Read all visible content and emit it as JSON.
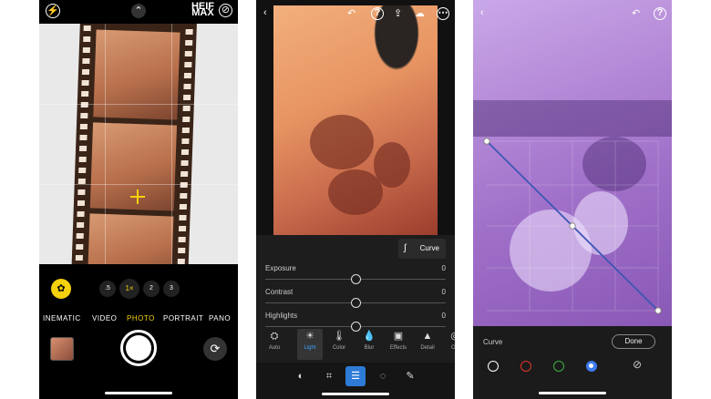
{
  "camera": {
    "format_label_top": "HEIF",
    "format_label_bottom": "MAX",
    "zoom_levels": [
      ".5",
      "1×",
      "2",
      "3"
    ],
    "active_zoom": "1×",
    "modes": [
      "INEMATIC",
      "VIDEO",
      "PHOTO",
      "PORTRAIT",
      "PANO"
    ],
    "active_mode": "PHOTO"
  },
  "editor": {
    "curve_button_label": "Curve",
    "sliders": [
      {
        "label": "Exposure",
        "value": "0",
        "position": 0.5
      },
      {
        "label": "Contrast",
        "value": "0",
        "position": 0.5
      },
      {
        "label": "Highlights",
        "value": "0",
        "position": 0.5
      }
    ],
    "tools": [
      {
        "label": "Auto",
        "icon": "auto-icon"
      },
      {
        "label": "Light",
        "icon": "sun-icon"
      },
      {
        "label": "Color",
        "icon": "thermometer-icon"
      },
      {
        "label": "Blur",
        "icon": "drop-icon"
      },
      {
        "label": "Effects",
        "icon": "effects-icon"
      },
      {
        "label": "Detail",
        "icon": "triangle-icon"
      },
      {
        "label": "Op",
        "icon": "optics-icon"
      }
    ],
    "active_tool": "Light",
    "accent_color": "#2d7bd6"
  },
  "curve_view": {
    "label": "Curve",
    "done_label": "Done",
    "channels": [
      {
        "name": "rgb",
        "color": "#ffffff"
      },
      {
        "name": "red",
        "color": "#e0362c"
      },
      {
        "name": "green",
        "color": "#3cb043"
      },
      {
        "name": "blue",
        "color": "#3e7bf0"
      }
    ],
    "active_channel": "blue",
    "curve_points": [
      [
        0,
        1
      ],
      [
        0.5,
        0.5
      ],
      [
        1,
        0
      ]
    ]
  }
}
